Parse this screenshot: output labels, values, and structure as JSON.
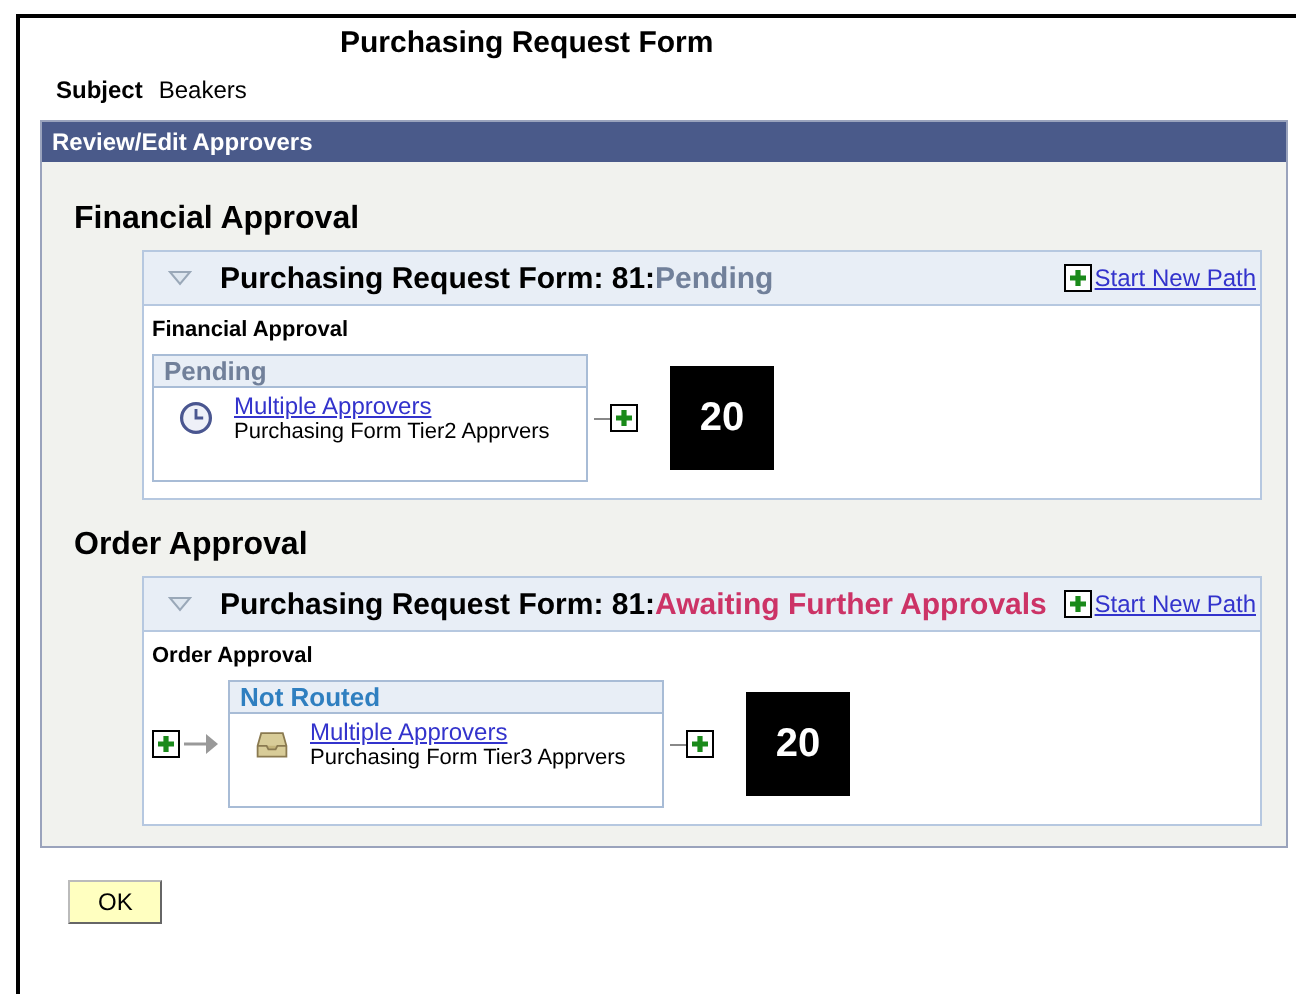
{
  "title": "Purchasing Request Form",
  "subject": {
    "label": "Subject",
    "value": "Beakers"
  },
  "panel_title": "Review/Edit Approvers",
  "sections": [
    {
      "heading": "Financial Approval",
      "path_title": "Purchasing Request Form: 81:",
      "path_status": {
        "text": "Pending",
        "color": "#71809a"
      },
      "start_link": "Start New Path",
      "stage_label": "Financial Approval",
      "leading_add": false,
      "step": {
        "status": "Pending",
        "color": "#71809a",
        "kind": "clock",
        "link": "Multiple Approvers",
        "detail": "Purchasing Form Tier2 Apprvers"
      },
      "badge": "20"
    },
    {
      "heading": "Order Approval",
      "path_title": "Purchasing Request Form: 81:",
      "path_status": {
        "text": "Awaiting Further Approvals",
        "color": "#cc3366"
      },
      "start_link": "Start New Path",
      "stage_label": "Order Approval",
      "leading_add": true,
      "step": {
        "status": "Not Routed",
        "color": "#2f7fc0",
        "kind": "tray",
        "link": "Multiple Approvers",
        "detail": "Purchasing Form Tier3 Apprvers"
      },
      "badge": "20"
    }
  ],
  "ok_button": "OK"
}
